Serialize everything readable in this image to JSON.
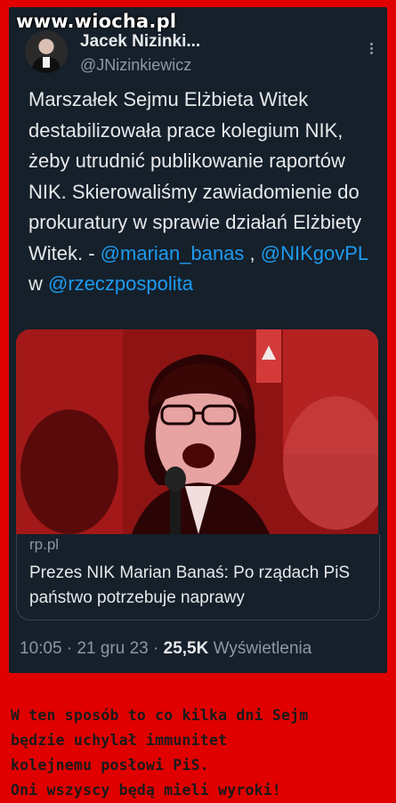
{
  "watermark": "www.wiocha.pl",
  "author": {
    "name": "Jacek Nizinki...",
    "handle": "@JNizinkiewicz"
  },
  "tweet": {
    "text": "Marszałek Sejmu Elżbieta Witek destabilizowała prace kolegium NIK, żeby utrudnić publikowanie raportów NIK. Skierowaliśmy zawiadomienie do prokuratury w sprawie działań Elżbiety Witek. - ",
    "mention1": "@marian_banas",
    "sep": " , ",
    "mention2": "@NIKgovPL",
    "w": " w ",
    "mention3": "@rzeczpospolita"
  },
  "card_link": {
    "domain": "rp.pl",
    "title": "Prezes NIK Marian Banaś: Po rządach PiS państwo potrzebuje naprawy"
  },
  "meta": {
    "time": "10:05",
    "date": "21 gru 23",
    "views_count": "25,5K",
    "views_label": "Wyświetlenia"
  },
  "caption": [
    "W ten sposób to co kilka dni Sejm",
    "będzie uchylał immunitet",
    "kolejnemu posłowi PiS.",
    "Oni wszyscy będą mieli wyroki!"
  ],
  "colors": {
    "frame": "#e00000",
    "card_bg": "#15202b",
    "link": "#1d9bf0",
    "text": "#e7e9ea",
    "muted": "#8b98a5"
  }
}
